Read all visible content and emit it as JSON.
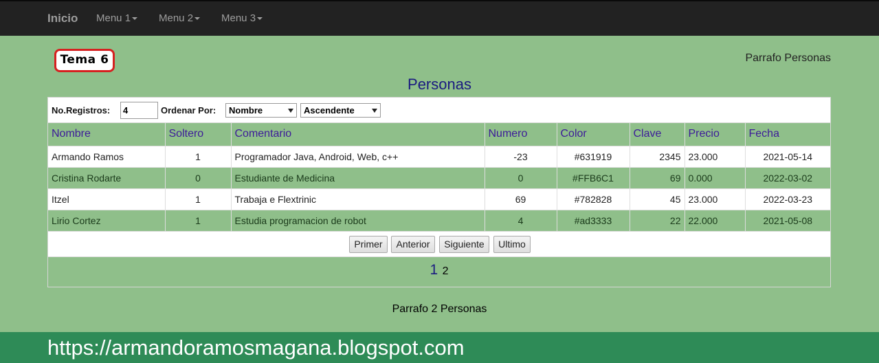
{
  "nav": {
    "brand": "Inicio",
    "menus": [
      "Menu 1",
      "Menu 2",
      "Menu 3"
    ]
  },
  "badge": "Tema 6",
  "paragraph_top": "Parrafo Personas",
  "page_title": "Personas",
  "controls": {
    "records_label": "No.Registros:",
    "records_value": "4",
    "order_label": "Ordenar Por:",
    "order_field": "Nombre",
    "order_direction": "Ascendente"
  },
  "table": {
    "headers": [
      "Nombre",
      "Soltero",
      "Comentario",
      "Numero",
      "Color",
      "Clave",
      "Precio",
      "Fecha"
    ],
    "rows": [
      [
        "Armando Ramos",
        "1",
        "Programador Java, Android, Web, c++",
        "-23",
        "#631919",
        "2345",
        "23.000",
        "2021-05-14"
      ],
      [
        "Cristina Rodarte",
        "0",
        "Estudiante de Medicina",
        "0",
        "#FFB6C1",
        "69",
        "0.000",
        "2022-03-02"
      ],
      [
        "Itzel",
        "1",
        "Trabaja e Flextrinic",
        "69",
        "#782828",
        "45",
        "23.000",
        "2022-03-23"
      ],
      [
        "Lirio Cortez",
        "1",
        "Estudia programacion de robot",
        "4",
        "#ad3333",
        "22",
        "22.000",
        "2021-05-08"
      ]
    ]
  },
  "pager": {
    "first": "Primer",
    "prev": "Anterior",
    "next": "Siguiente",
    "last": "Ultimo",
    "page1": "1",
    "page2": "2"
  },
  "paragraph_bottom": "Parrafo 2 Personas",
  "footer": "https://armandoramosmagana.blogspot.com",
  "colors": {
    "background": "#8fbf8a",
    "navbar": "#222222",
    "footer": "#2e8b57",
    "header_text": "#3c1a99",
    "badge_border": "#d62020"
  }
}
